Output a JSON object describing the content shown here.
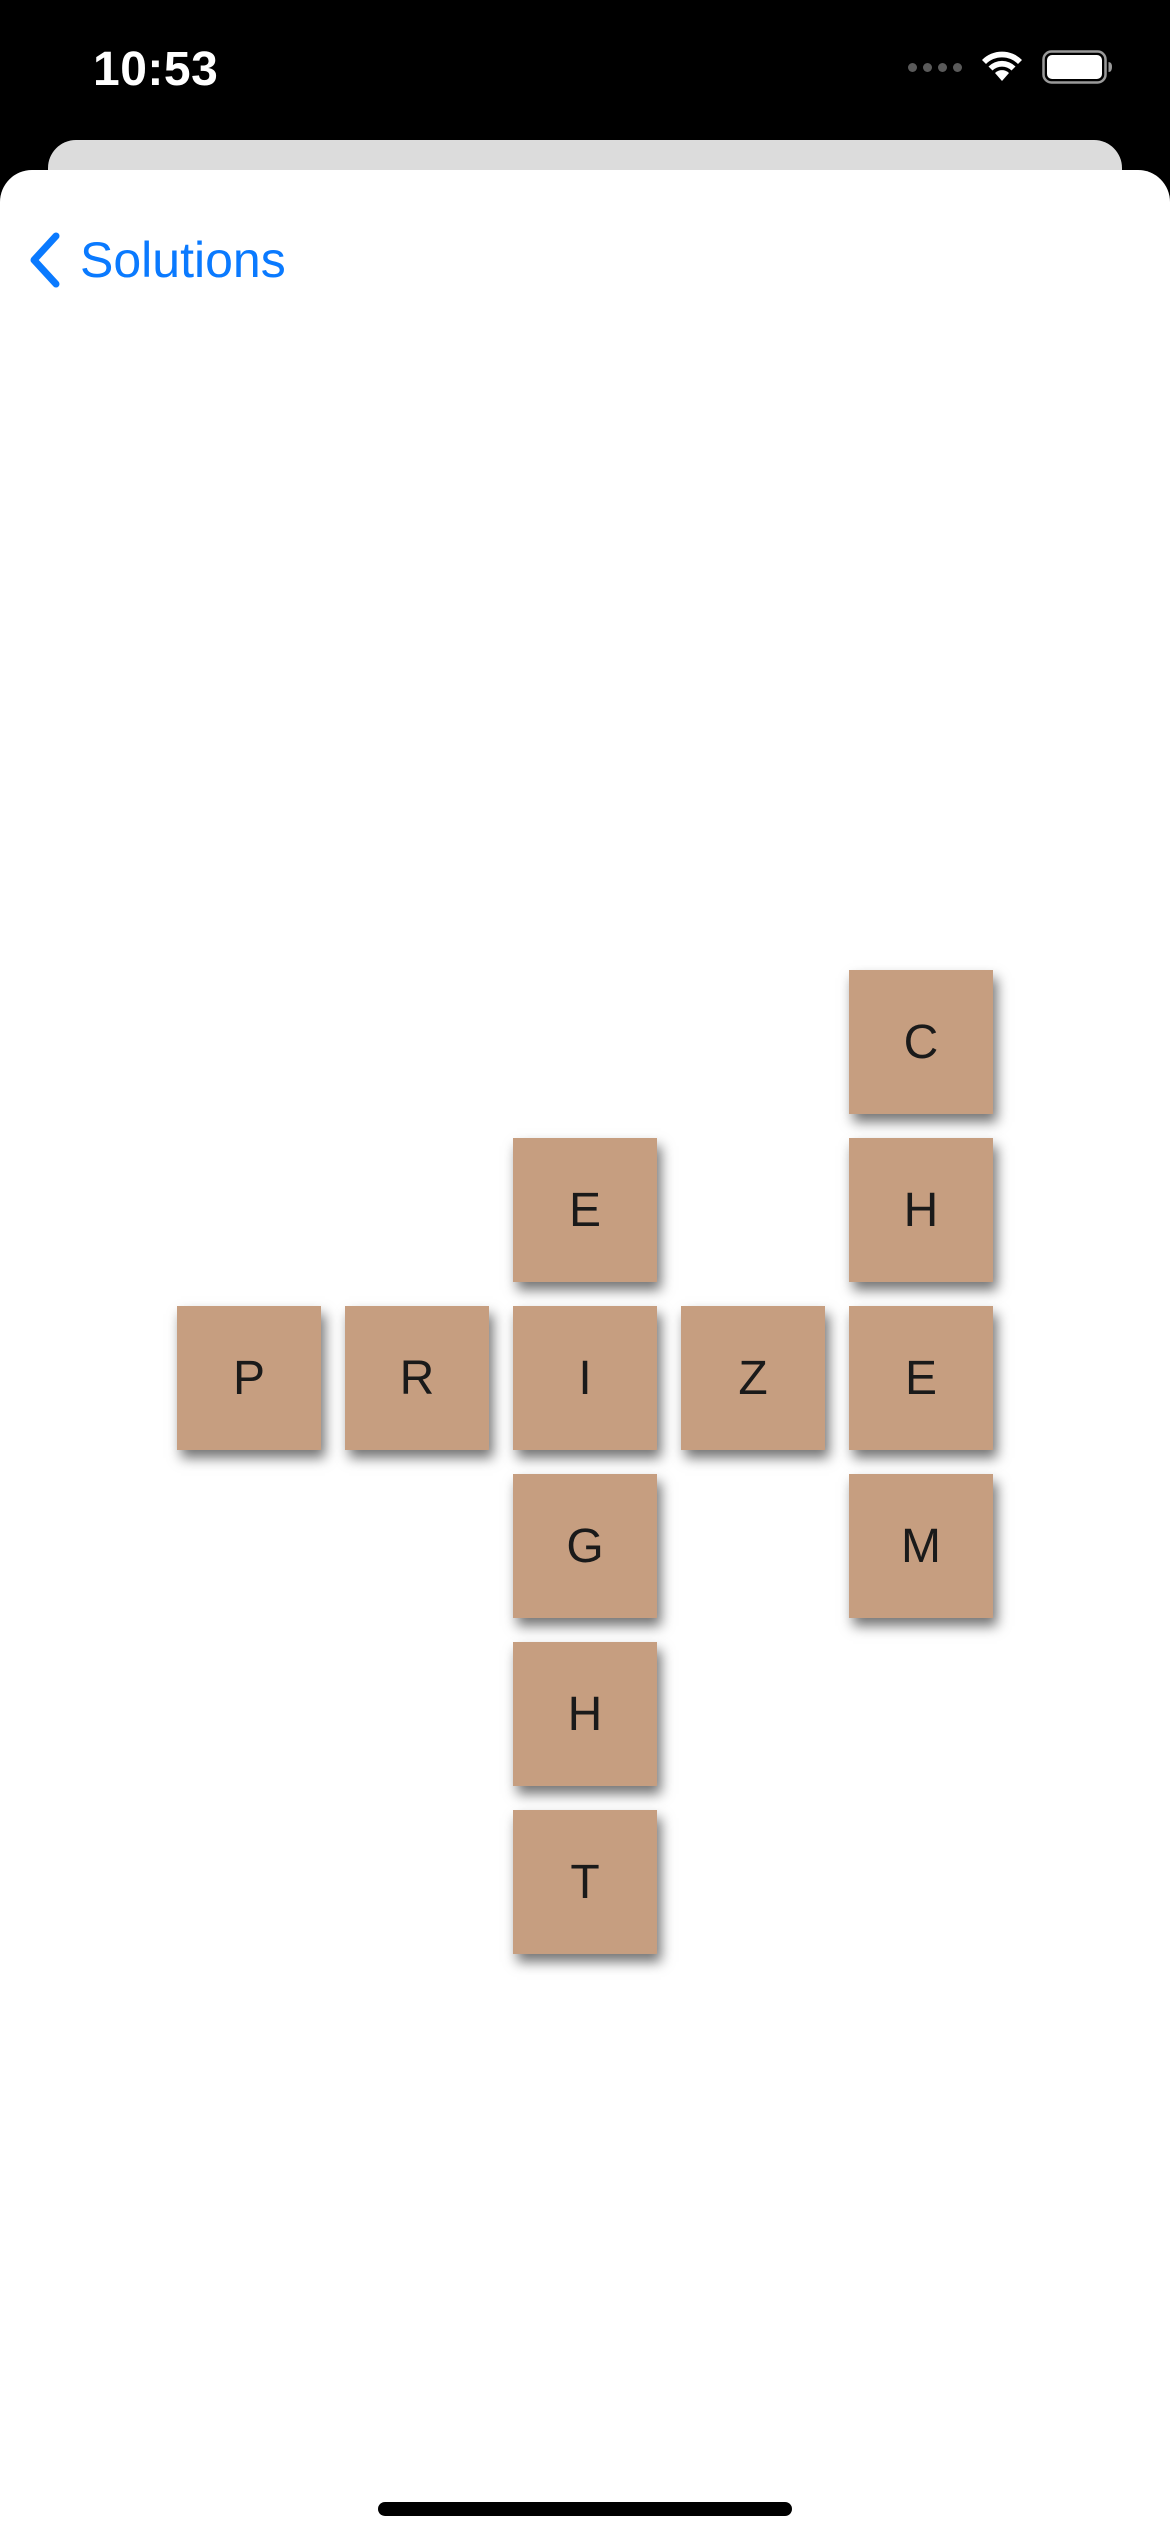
{
  "status_bar": {
    "time": "10:53",
    "icons": [
      "cellular-signal-icon",
      "wifi-icon",
      "battery-icon"
    ]
  },
  "nav": {
    "back_label": "Solutions",
    "back_icon": "chevron-left-icon"
  },
  "colors": {
    "accent": "#0a7aff",
    "tile": "#c69e80",
    "tile_text": "#1a1a1a",
    "background": "#ffffff"
  },
  "puzzle": {
    "words": [
      "PRIZE",
      "EIGHT",
      "CHEM"
    ],
    "grid_rows": [
      {
        "row": 0,
        "tiles": [
          {
            "col": 4,
            "letter": "C"
          }
        ]
      },
      {
        "row": 1,
        "tiles": [
          {
            "col": 2,
            "letter": "E"
          },
          {
            "col": 4,
            "letter": "H"
          }
        ]
      },
      {
        "row": 2,
        "tiles": [
          {
            "col": 0,
            "letter": "P"
          },
          {
            "col": 1,
            "letter": "R"
          },
          {
            "col": 2,
            "letter": "I"
          },
          {
            "col": 3,
            "letter": "Z"
          },
          {
            "col": 4,
            "letter": "E"
          }
        ]
      },
      {
        "row": 3,
        "tiles": [
          {
            "col": 2,
            "letter": "G"
          },
          {
            "col": 4,
            "letter": "M"
          }
        ]
      },
      {
        "row": 4,
        "tiles": [
          {
            "col": 2,
            "letter": "H"
          }
        ]
      },
      {
        "row": 5,
        "tiles": [
          {
            "col": 2,
            "letter": "T"
          }
        ]
      }
    ]
  }
}
